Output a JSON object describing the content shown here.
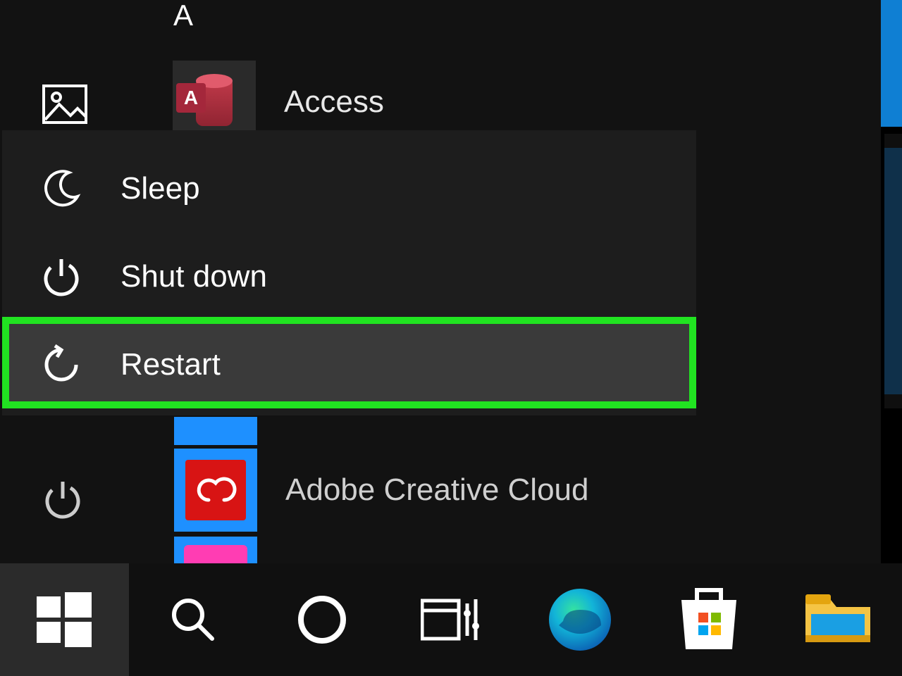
{
  "start_menu": {
    "section_header": "A",
    "apps": {
      "access": {
        "label": "Access",
        "badge_letter": "A"
      },
      "adobe_cc": {
        "label": "Adobe Creative Cloud"
      }
    },
    "sidebar": {
      "pictures_icon": "pictures-icon",
      "power_icon": "power-icon"
    }
  },
  "power_menu": {
    "sleep": "Sleep",
    "shutdown": "Shut down",
    "restart": "Restart"
  },
  "taskbar": {
    "items": [
      "start",
      "search",
      "cortana",
      "task-view",
      "edge",
      "store",
      "file-explorer"
    ]
  },
  "highlight": {
    "target": "restart",
    "color": "#21e321"
  }
}
